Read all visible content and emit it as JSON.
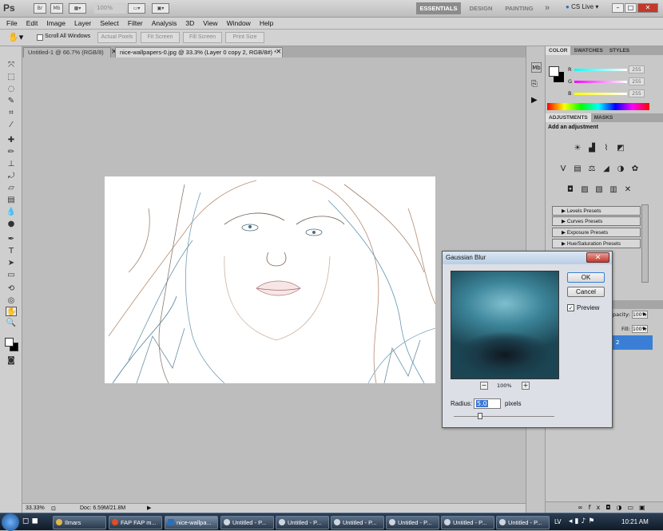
{
  "app": {
    "logo": "Ps",
    "icon_labels": [
      "Br",
      "Mb"
    ],
    "zoom": "100%"
  },
  "workspaces": {
    "essentials": "ESSENTIALS",
    "design": "DESIGN",
    "painting": "PAINTING",
    "more": "»"
  },
  "cslive": "CS Live",
  "window_buttons": {
    "minimize": "–",
    "restore": "□",
    "close": "✕"
  },
  "menu": [
    "File",
    "Edit",
    "Image",
    "Layer",
    "Select",
    "Filter",
    "Analysis",
    "3D",
    "View",
    "Window",
    "Help"
  ],
  "options": {
    "scroll_all_windows": "Scroll All Windows",
    "actual_pixels": "Actual Pixels",
    "fit_screen": "Fit Screen",
    "fill_screen": "Fill Screen",
    "print_size": "Print Size"
  },
  "tabs": [
    {
      "label": "Untitled-1 @ 66.7% (RGB/8)"
    },
    {
      "label": "nice-wallpapers-0.jpg @ 33.3% (Layer 0 copy 2, RGB/8#) *"
    }
  ],
  "tab_close": "×",
  "status": {
    "zoom": "33.33%",
    "doc": "Doc: 6.59M/21.8M"
  },
  "color_panel": {
    "tabs": [
      "COLOR",
      "SWATCHES",
      "STYLES"
    ],
    "r": "255",
    "g": "255",
    "b": "255",
    "r_label": "R",
    "g_label": "G",
    "b_label": "B"
  },
  "adjustments_panel": {
    "tabs": [
      "ADJUSTMENTS",
      "MASKS"
    ],
    "heading": "Add an adjustment",
    "presets": [
      "Levels Presets",
      "Curves Presets",
      "Exposure Presets",
      "Hue/Saturation Presets"
    ]
  },
  "layers_panel": {
    "opacity_label": "pacity:",
    "opacity": "100%",
    "fill_label": "Fill:",
    "fill": "100%",
    "layer_label": "2"
  },
  "dialog": {
    "title": "Gaussian Blur",
    "ok": "OK",
    "cancel": "Cancel",
    "preview_label": "Preview",
    "zoom": "100%",
    "zoom_minus": "−",
    "zoom_plus": "+",
    "radius_label": "Radius:",
    "radius_value": "5.0",
    "radius_unit": "pixels"
  },
  "taskbar": {
    "items": [
      "Ilmars",
      "FAP FAP m...",
      "nice-wallpa...",
      "Untitled - P...",
      "Untitled - P...",
      "Untitled - P...",
      "Untitled - P...",
      "Untitled - P...",
      "Untitled - P..."
    ],
    "lang": "LV",
    "time": "10:21 AM"
  }
}
